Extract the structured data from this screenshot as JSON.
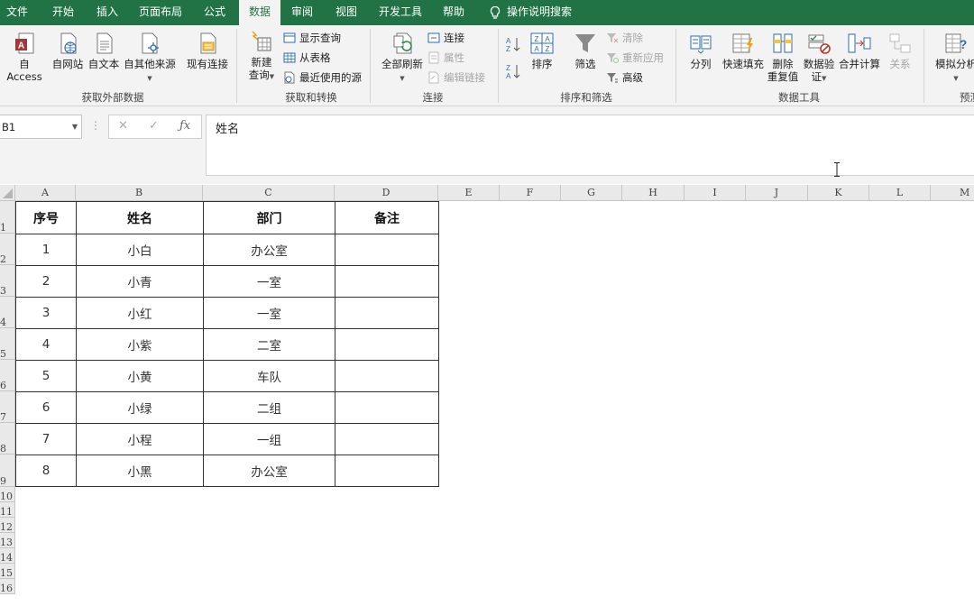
{
  "tabs": [
    {
      "label": "文件",
      "name": "tab-file"
    },
    {
      "label": "开始",
      "name": "tab-home"
    },
    {
      "label": "插入",
      "name": "tab-insert"
    },
    {
      "label": "页面布局",
      "name": "tab-page-layout"
    },
    {
      "label": "公式",
      "name": "tab-formulas"
    },
    {
      "label": "数据",
      "name": "tab-data",
      "active": true
    },
    {
      "label": "审阅",
      "name": "tab-review"
    },
    {
      "label": "视图",
      "name": "tab-view"
    },
    {
      "label": "开发工具",
      "name": "tab-developer"
    },
    {
      "label": "帮助",
      "name": "tab-help"
    }
  ],
  "tell_me": "操作说明搜索",
  "ribbon": {
    "get_external": {
      "label": "获取外部数据",
      "from_access": "自 Access",
      "from_web": "自网站",
      "from_text": "自文本",
      "from_other": "自其他来源",
      "existing": "现有连接"
    },
    "get_transform": {
      "label": "获取和转换",
      "new_query": "新建",
      "new_query_2": "查询",
      "show_queries": "显示查询",
      "from_table": "从表格",
      "recent_sources": "最近使用的源"
    },
    "connections": {
      "label": "连接",
      "refresh_all": "全部刷新",
      "connections": "连接",
      "properties": "属性",
      "edit_links": "编辑链接"
    },
    "sort_filter": {
      "label": "排序和筛选",
      "sort": "排序",
      "filter": "筛选",
      "clear": "清除",
      "reapply": "重新应用",
      "advanced": "高级"
    },
    "data_tools": {
      "label": "数据工具",
      "text_to_columns": "分列",
      "flash_fill": "快速填充",
      "remove_dup_1": "删除",
      "remove_dup_2": "重复值",
      "validation_1": "数据验",
      "validation_2": "证",
      "consolidate": "合并计算",
      "relationships": "关系"
    },
    "forecast": {
      "label": "预测",
      "what_if": "模拟分析"
    }
  },
  "name_box": "B1",
  "formula_value": "姓名",
  "columns": [
    "A",
    "B",
    "C",
    "D",
    "E",
    "F",
    "G",
    "H",
    "I",
    "J",
    "K",
    "L",
    "M"
  ],
  "rows": [
    "1",
    "2",
    "3",
    "4",
    "5",
    "6",
    "7",
    "8",
    "9",
    "10",
    "11",
    "12",
    "13",
    "14",
    "15",
    "16"
  ],
  "table": {
    "headers": [
      "序号",
      "姓名",
      "部门",
      "备注"
    ],
    "rows": [
      [
        "1",
        "小白",
        "办公室",
        ""
      ],
      [
        "2",
        "小青",
        "一室",
        ""
      ],
      [
        "3",
        "小红",
        "一室",
        ""
      ],
      [
        "4",
        "小紫",
        "二室",
        ""
      ],
      [
        "5",
        "小黄",
        "车队",
        ""
      ],
      [
        "6",
        "小绿",
        "二组",
        ""
      ],
      [
        "7",
        "小程",
        "一组",
        ""
      ],
      [
        "8",
        "小黑",
        "办公室",
        ""
      ]
    ]
  },
  "colors": {
    "excel_green": "#217346",
    "ribbon_bg": "#f3f3f3"
  }
}
